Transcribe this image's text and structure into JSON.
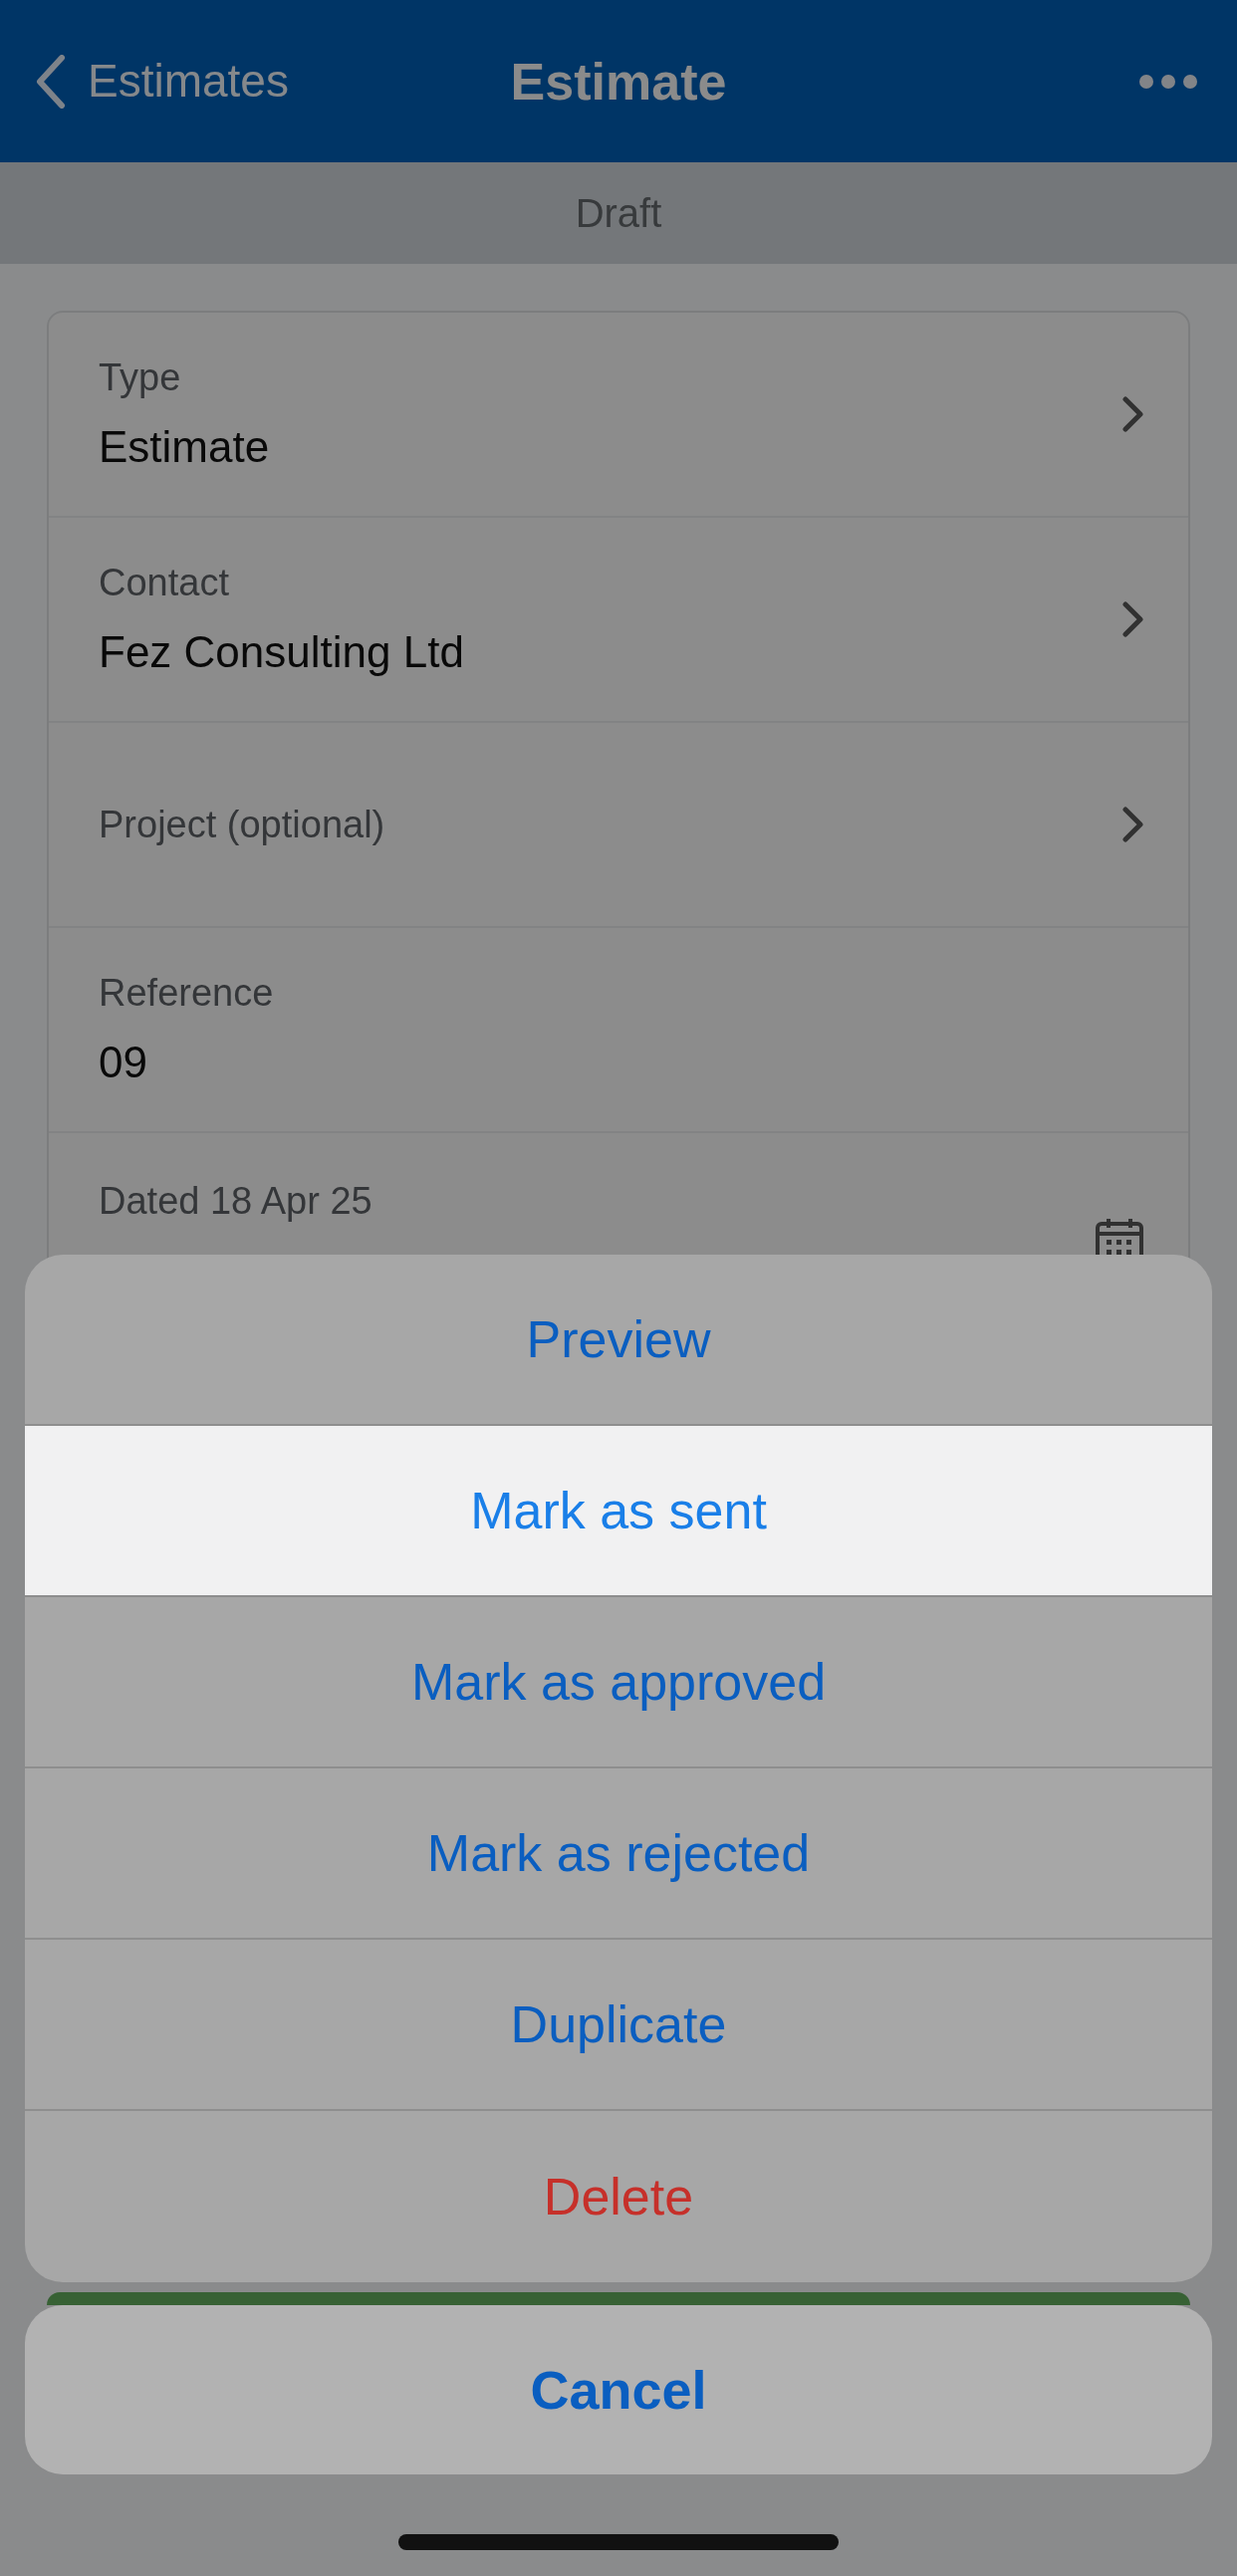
{
  "nav": {
    "back": "Estimates",
    "title": "Estimate"
  },
  "status": "Draft",
  "fields": [
    {
      "label": "Type",
      "value": "Estimate",
      "kind": "chevron"
    },
    {
      "label": "Contact",
      "value": "Fez Consulting Ltd",
      "kind": "chevron"
    },
    {
      "label": "Project (optional)",
      "kind": "chevron"
    },
    {
      "label": "Reference",
      "value": "09",
      "kind": "plain"
    },
    {
      "label": "Dated 18 Apr 25",
      "kind": "date"
    }
  ],
  "actions": [
    {
      "label": "Preview",
      "kind": "default",
      "selected": false
    },
    {
      "label": "Mark as sent",
      "kind": "default",
      "selected": true
    },
    {
      "label": "Mark as approved",
      "kind": "default",
      "selected": false
    },
    {
      "label": "Mark as rejected",
      "kind": "default",
      "selected": false
    },
    {
      "label": "Duplicate",
      "kind": "default",
      "selected": false
    },
    {
      "label": "Delete",
      "kind": "destructive",
      "selected": false
    }
  ],
  "cancel": "Cancel"
}
